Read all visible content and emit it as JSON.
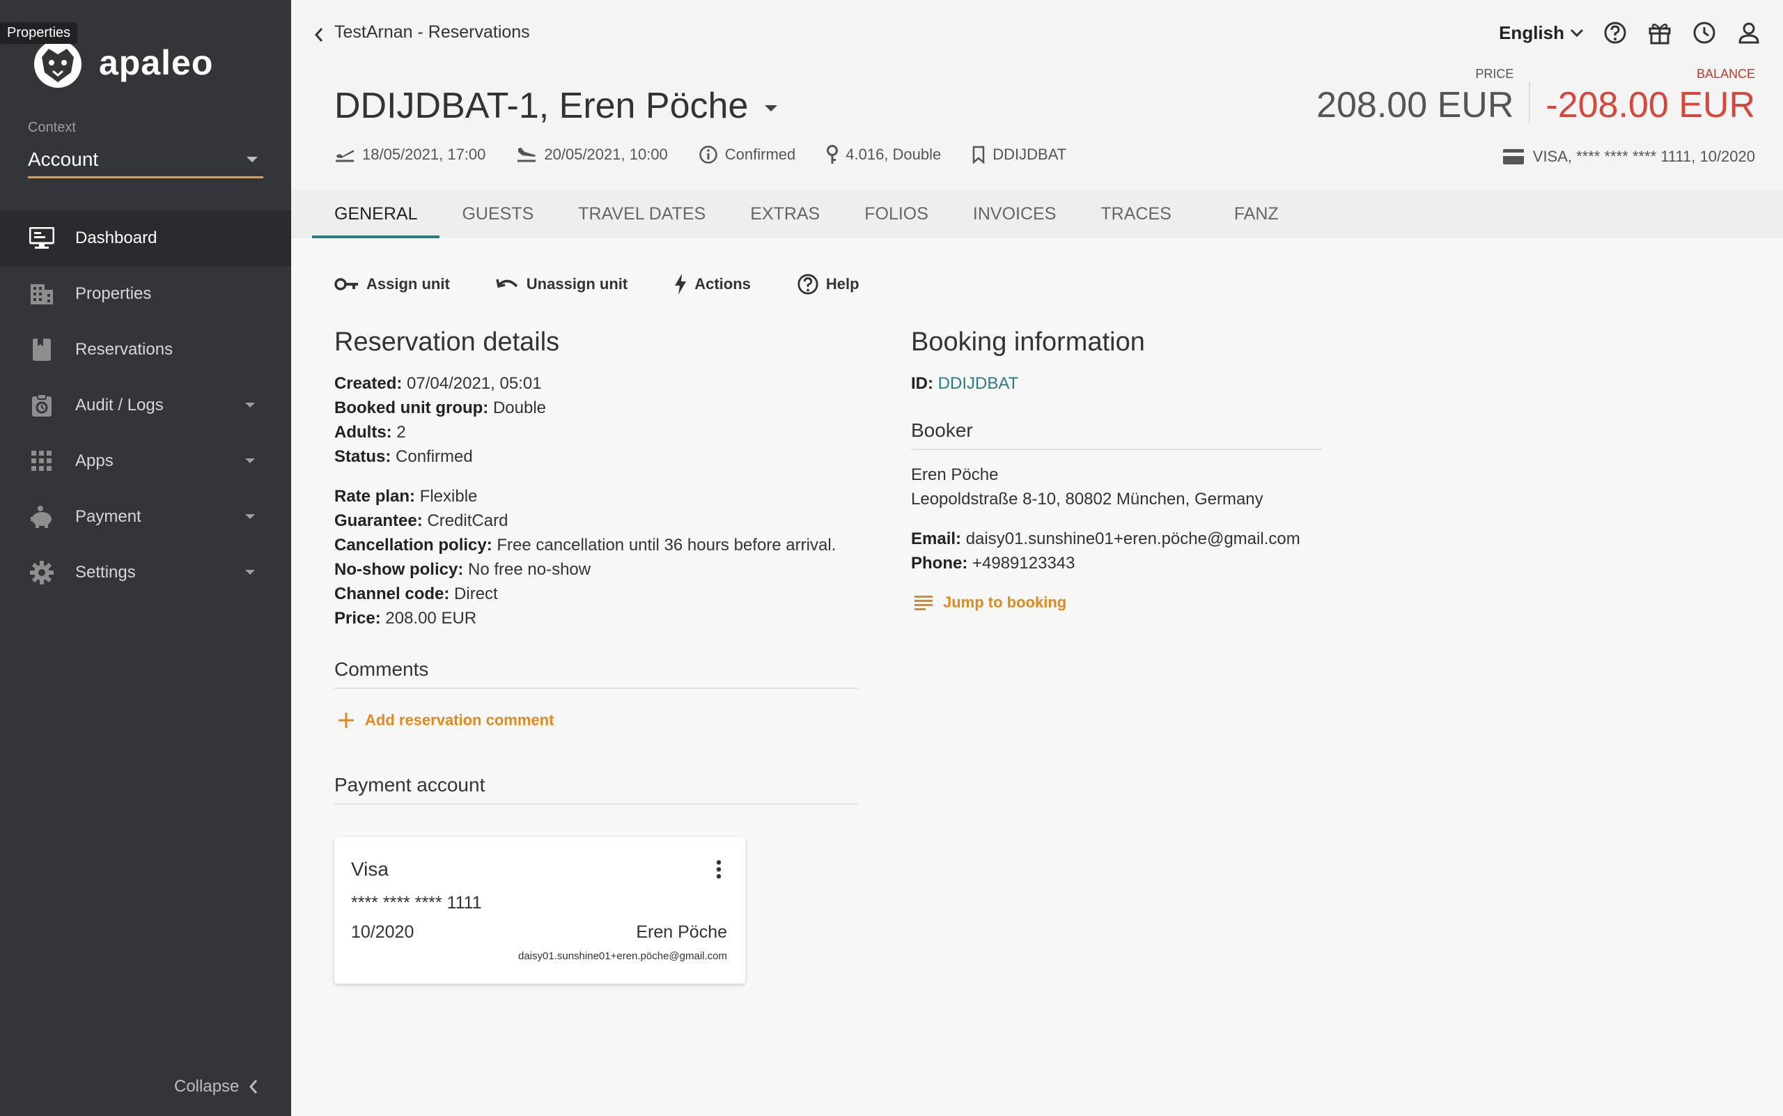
{
  "sidebar": {
    "tooltip": "Properties",
    "logo_text": "apaleo",
    "context_label": "Context",
    "context_value": "Account",
    "items": [
      {
        "label": "Dashboard"
      },
      {
        "label": "Properties"
      },
      {
        "label": "Reservations"
      },
      {
        "label": "Audit / Logs"
      },
      {
        "label": "Apps"
      },
      {
        "label": "Payment"
      },
      {
        "label": "Settings"
      }
    ],
    "collapse_label": "Collapse"
  },
  "header": {
    "breadcrumb": "TestArnan - Reservations",
    "language": "English",
    "title": "DDIJDBAT-1, Eren Pöche",
    "price_label": "PRICE",
    "price_value": "208.00 EUR",
    "balance_label": "BALANCE",
    "balance_value": "-208.00 EUR",
    "arrival": "18/05/2021, 17:00",
    "departure": "20/05/2021, 10:00",
    "status": "Confirmed",
    "unit": "4.016, Double",
    "booking_id": "DDIJDBAT",
    "card_info": "VISA, **** **** **** 1111, 10/2020"
  },
  "tabs": [
    "GENERAL",
    "GUESTS",
    "TRAVEL DATES",
    "EXTRAS",
    "FOLIOS",
    "INVOICES",
    "TRACES",
    "FANZ"
  ],
  "toolbar": {
    "assign": "Assign unit",
    "unassign": "Unassign unit",
    "actions": "Actions",
    "help": "Help"
  },
  "reservation": {
    "title": "Reservation details",
    "created_label": "Created:",
    "created": "07/04/2021, 05:01",
    "unit_group_label": "Booked unit group:",
    "unit_group": "Double",
    "adults_label": "Adults:",
    "adults": "2",
    "status_label": "Status:",
    "status": "Confirmed",
    "rate_plan_label": "Rate plan:",
    "rate_plan": "Flexible",
    "guarantee_label": "Guarantee:",
    "guarantee": "CreditCard",
    "cancel_label": "Cancellation policy:",
    "cancel": "Free cancellation until 36 hours before arrival.",
    "noshow_label": "No-show policy:",
    "noshow": "No free no-show",
    "channel_label": "Channel code:",
    "channel": "Direct",
    "price_label": "Price:",
    "price": "208.00 EUR",
    "comments_title": "Comments",
    "add_comment": "Add reservation comment",
    "payment_title": "Payment account"
  },
  "payment_card": {
    "brand": "Visa",
    "number": "**** **** **** 1111",
    "expiry": "10/2020",
    "holder": "Eren Pöche",
    "email": "daisy01.sunshine01+eren.pöche@gmail.com"
  },
  "booking": {
    "title": "Booking information",
    "id_label": "ID:",
    "id": "DDIJDBAT",
    "booker_title": "Booker",
    "name": "Eren Pöche",
    "address": "Leopoldstraße 8-10, 80802 München, Germany",
    "email_label": "Email:",
    "email": "daisy01.sunshine01+eren.pöche@gmail.com",
    "phone_label": "Phone:",
    "phone": "+4989123343",
    "jump": "Jump to booking"
  },
  "colors": {
    "accent_orange": "#e08a1e",
    "teal": "#2b7a84",
    "balance_red": "#d6463a",
    "sidebar_bg": "#333539"
  }
}
